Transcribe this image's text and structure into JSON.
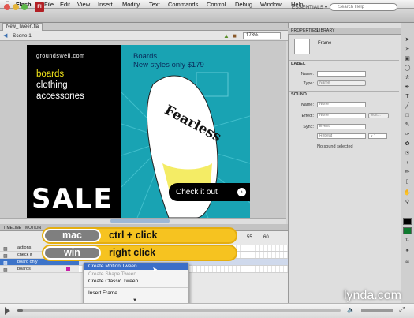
{
  "menubar": {
    "app": "Flash",
    "items": [
      "File",
      "Edit",
      "View",
      "Insert",
      "Modify",
      "Text",
      "Commands",
      "Control",
      "Debug",
      "Window",
      "Help"
    ]
  },
  "toolbar": {
    "logo": "Fl",
    "workspace": "ESSENTIALS ▾",
    "search_placeholder": "Search Help"
  },
  "document": {
    "tab": "New_Tween.fla",
    "scene": "Scene 1",
    "zoom": "173%"
  },
  "stage": {
    "logo_text": "groundswell.com",
    "nav": [
      {
        "label": "boards",
        "color": "#f3e51a"
      },
      {
        "label": "clothing",
        "color": "#ffffff"
      },
      {
        "label": "accessories",
        "color": "#ffffff"
      }
    ],
    "sale": "SALE",
    "title_line1": "Boards",
    "title_line2": "New styles only $179",
    "board_text": "Fearless",
    "cta": "Check it out",
    "cta_icon": "›"
  },
  "panel": {
    "tabs": [
      "PROPERTIES",
      "LIBRARY"
    ],
    "frame_label": "Frame",
    "label_section": "LABEL",
    "name_label": "Name:",
    "type_label": "Type:",
    "type_value": "Name",
    "sound_section": "SOUND",
    "sound_name_value": "None",
    "effect_label": "Effect:",
    "effect_value": "None",
    "edit_button": "Edit...",
    "sync_label": "Sync:",
    "sync_value": "Event",
    "repeat_value": "Repeat",
    "repeat_count": "x 1",
    "no_sound": "No sound selected"
  },
  "timeline": {
    "tabs": [
      "TIMELINE",
      "MOTION"
    ],
    "ruler": [
      "55",
      "60"
    ],
    "layers": [
      "actions",
      "check it",
      "board only",
      "boards"
    ]
  },
  "callouts": [
    {
      "key": "mac",
      "text": "ctrl + click"
    },
    {
      "key": "win",
      "text": "right click"
    }
  ],
  "context_menu": {
    "items": [
      "Create Motion Tween",
      "Create Shape Tween",
      "Create Classic Tween",
      "Insert Frame"
    ]
  },
  "watermark": "lynda.com"
}
